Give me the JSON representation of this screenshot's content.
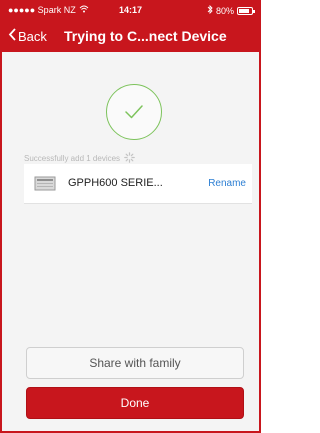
{
  "status_bar": {
    "carrier": "●●●●● Spark NZ",
    "time": "14:17",
    "battery": "80%",
    "battery_level": 0.8,
    "icons": [
      "wifi-icon",
      "bluetooth-icon",
      "battery-icon"
    ]
  },
  "nav": {
    "back_label": "Back",
    "title": "Trying to C...nect Device"
  },
  "status": {
    "message": "Successfully add 1 devices"
  },
  "devices": [
    {
      "name": "GPPH600 SERIE...",
      "action": "Rename",
      "icon": "device-icon"
    }
  ],
  "actions": {
    "share_label": "Share with family",
    "done_label": "Done"
  },
  "colors": {
    "brand_red": "#c8161d",
    "success_green": "#7dc35c",
    "link_blue": "#2d7fd3"
  }
}
